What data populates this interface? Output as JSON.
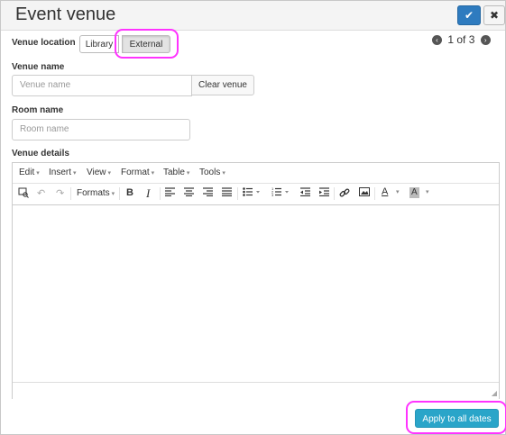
{
  "dialog": {
    "title": "Event venue",
    "confirm_icon": "✔",
    "close_icon": "✖"
  },
  "venue_location": {
    "label": "Venue location",
    "options": [
      "Library",
      "External"
    ],
    "selected": "External"
  },
  "pager": {
    "text": "1 of 3",
    "prev_icon": "‹",
    "next_icon": "›"
  },
  "venue_name": {
    "label": "Venue name",
    "placeholder": "Venue name",
    "clear_label": "Clear venue"
  },
  "room_name": {
    "label": "Room name",
    "placeholder": "Room name"
  },
  "venue_details": {
    "label": "Venue details",
    "menus": [
      "Edit",
      "Insert",
      "View",
      "Format",
      "Table",
      "Tools"
    ],
    "toolbar": {
      "formats_label": "Formats",
      "bold": "B",
      "italic": "I",
      "text_color": "A",
      "bg_color": "A"
    }
  },
  "apply_button": "Apply to all dates",
  "colors": {
    "accent_blue": "#2e7bbf",
    "apply_teal": "#2aa5c9",
    "highlight": "#ff33ff"
  }
}
